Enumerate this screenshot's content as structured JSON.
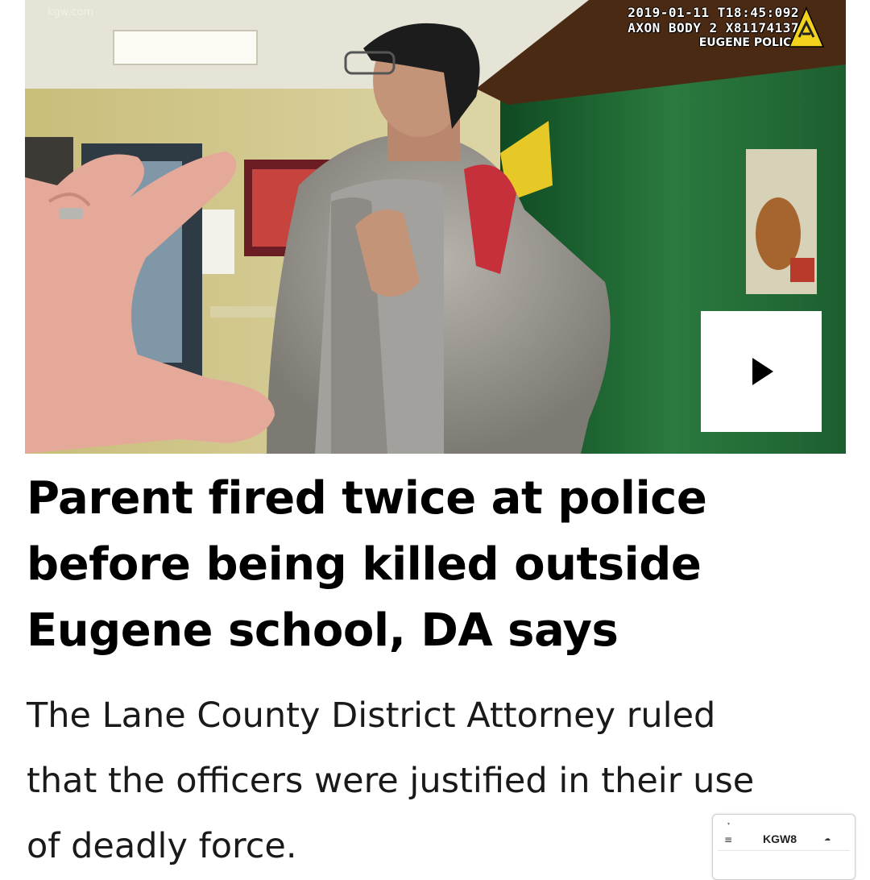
{
  "video": {
    "watermark": "kgw.com",
    "overlay": {
      "timestamp": "2019-01-11 T18:45:092",
      "device": "AXON BODY 2 X81174137",
      "department": "EUGENE POLICE"
    },
    "play_icon": "play-icon",
    "logo_icon": "axon-triangle-logo"
  },
  "article": {
    "headline_lines": [
      "Parent fired twice at police",
      "before being killed outside",
      "Eugene school, DA says"
    ],
    "summary_lines": [
      "The Lane County District Attorney ruled",
      "that the officers were justified in their use",
      "of deadly force."
    ]
  },
  "thumbnail": {
    "menu_icon": "hamburger-menu-icon",
    "brand": "KGW8",
    "weather_icon": "cloud-icon"
  },
  "colors": {
    "wall_green": "#1f6a34",
    "wall_yellow": "#cfc58a",
    "overlay_text": "#ffffff",
    "axon_yellow": "#f2d21c"
  }
}
